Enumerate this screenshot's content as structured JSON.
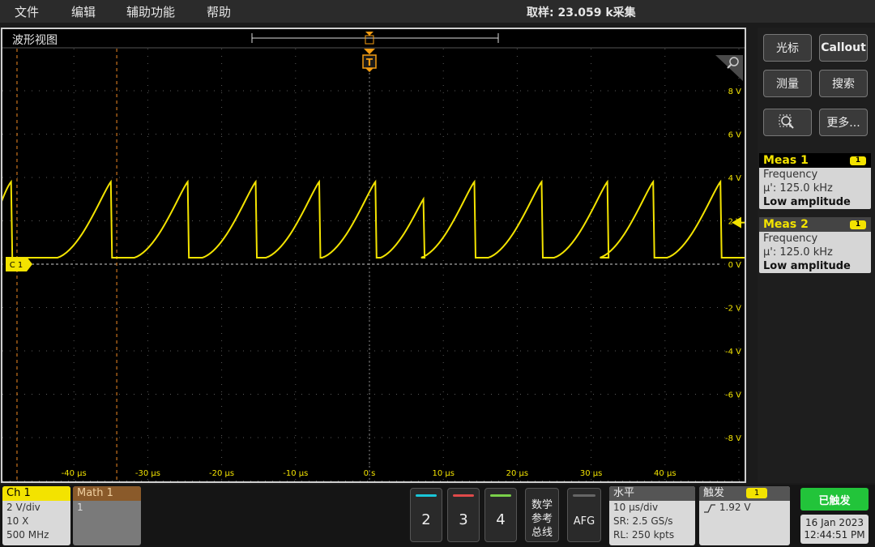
{
  "menu": [
    "文件",
    "编辑",
    "辅助功能",
    "帮助"
  ],
  "acq_status": "取样: 23.059 k采集",
  "waveform_view": {
    "title": "波形视图",
    "trigger_marker": "T",
    "channel_marker": "C 1",
    "y_labels": [
      "8 V",
      "6 V",
      "4 V",
      "2 V",
      "0 V",
      "-2 V",
      "-4 V",
      "-6 V",
      "-8 V"
    ],
    "x_labels": [
      "-40 µs",
      "-30 µs",
      "-20 µs",
      "-10 µs",
      "0 s",
      "10 µs",
      "20 µs",
      "30 µs",
      "40 µs"
    ]
  },
  "chart_data": {
    "type": "line",
    "title": "",
    "xlabel": "",
    "ylabel": "",
    "xlim": [
      -50,
      50
    ],
    "ylim": [
      -10,
      10
    ],
    "y_ticks": [
      8,
      6,
      4,
      2,
      0,
      -2,
      -4,
      -6,
      -8
    ],
    "x_ticks": [
      -40,
      -30,
      -20,
      -10,
      0,
      10,
      20,
      30,
      40
    ],
    "series": [
      {
        "color": "#f3e300",
        "peaks_x": [
          -48.5,
          -35,
          -24.6,
          -15.4,
          -6.8,
          0.8,
          7.3,
          14.2,
          23.3,
          32.2,
          38.4,
          47.5
        ],
        "peak_v": [
          3.8,
          3.8,
          3.8,
          3.8,
          3.8,
          3.8,
          3.0,
          3.8,
          3.8,
          3.8,
          3.8,
          3.8
        ],
        "baseline_v": 0.3
      }
    ],
    "cursors_x": [
      -47.7,
      -34.2
    ],
    "trigger_level_v": 1.92
  },
  "right_panel": {
    "buttons": [
      "光标",
      "Callout",
      "测量",
      "搜索",
      "更多..."
    ],
    "meas1": {
      "title": "Meas 1",
      "badge": "1",
      "line1": "Frequency",
      "line2": "µ': 125.0 kHz",
      "line3": "Low amplitude"
    },
    "meas2": {
      "title": "Meas 2",
      "badge": "1",
      "line1": "Frequency",
      "line2": "µ': 125.0 kHz",
      "line3": "Low amplitude"
    }
  },
  "bottom": {
    "ch1": {
      "title": "Ch 1",
      "scale": "2 V/div",
      "probe": "10 X",
      "bw": "500 MHz",
      "color": "#f3e300"
    },
    "math1": {
      "title": "Math 1",
      "value": "1",
      "color": "#b5651d"
    },
    "channel_buttons": [
      {
        "label": "2",
        "color": "#19c6d8"
      },
      {
        "label": "3",
        "color": "#e04a4a"
      },
      {
        "label": "4",
        "color": "#7ad04a"
      }
    ],
    "math_bus": [
      "数学",
      "参考",
      "总线"
    ],
    "afg": "AFG",
    "horizontal": {
      "title": "水平",
      "scale": "10 µs/div",
      "sr": "SR: 2.5 GS/s",
      "rl": "RL: 250 kpts"
    },
    "trigger": {
      "title": "触发",
      "badge": "1",
      "level": "1.92 V"
    },
    "triggered": "已触发",
    "date": "16 Jan 2023",
    "time": "12:44:51 PM"
  }
}
